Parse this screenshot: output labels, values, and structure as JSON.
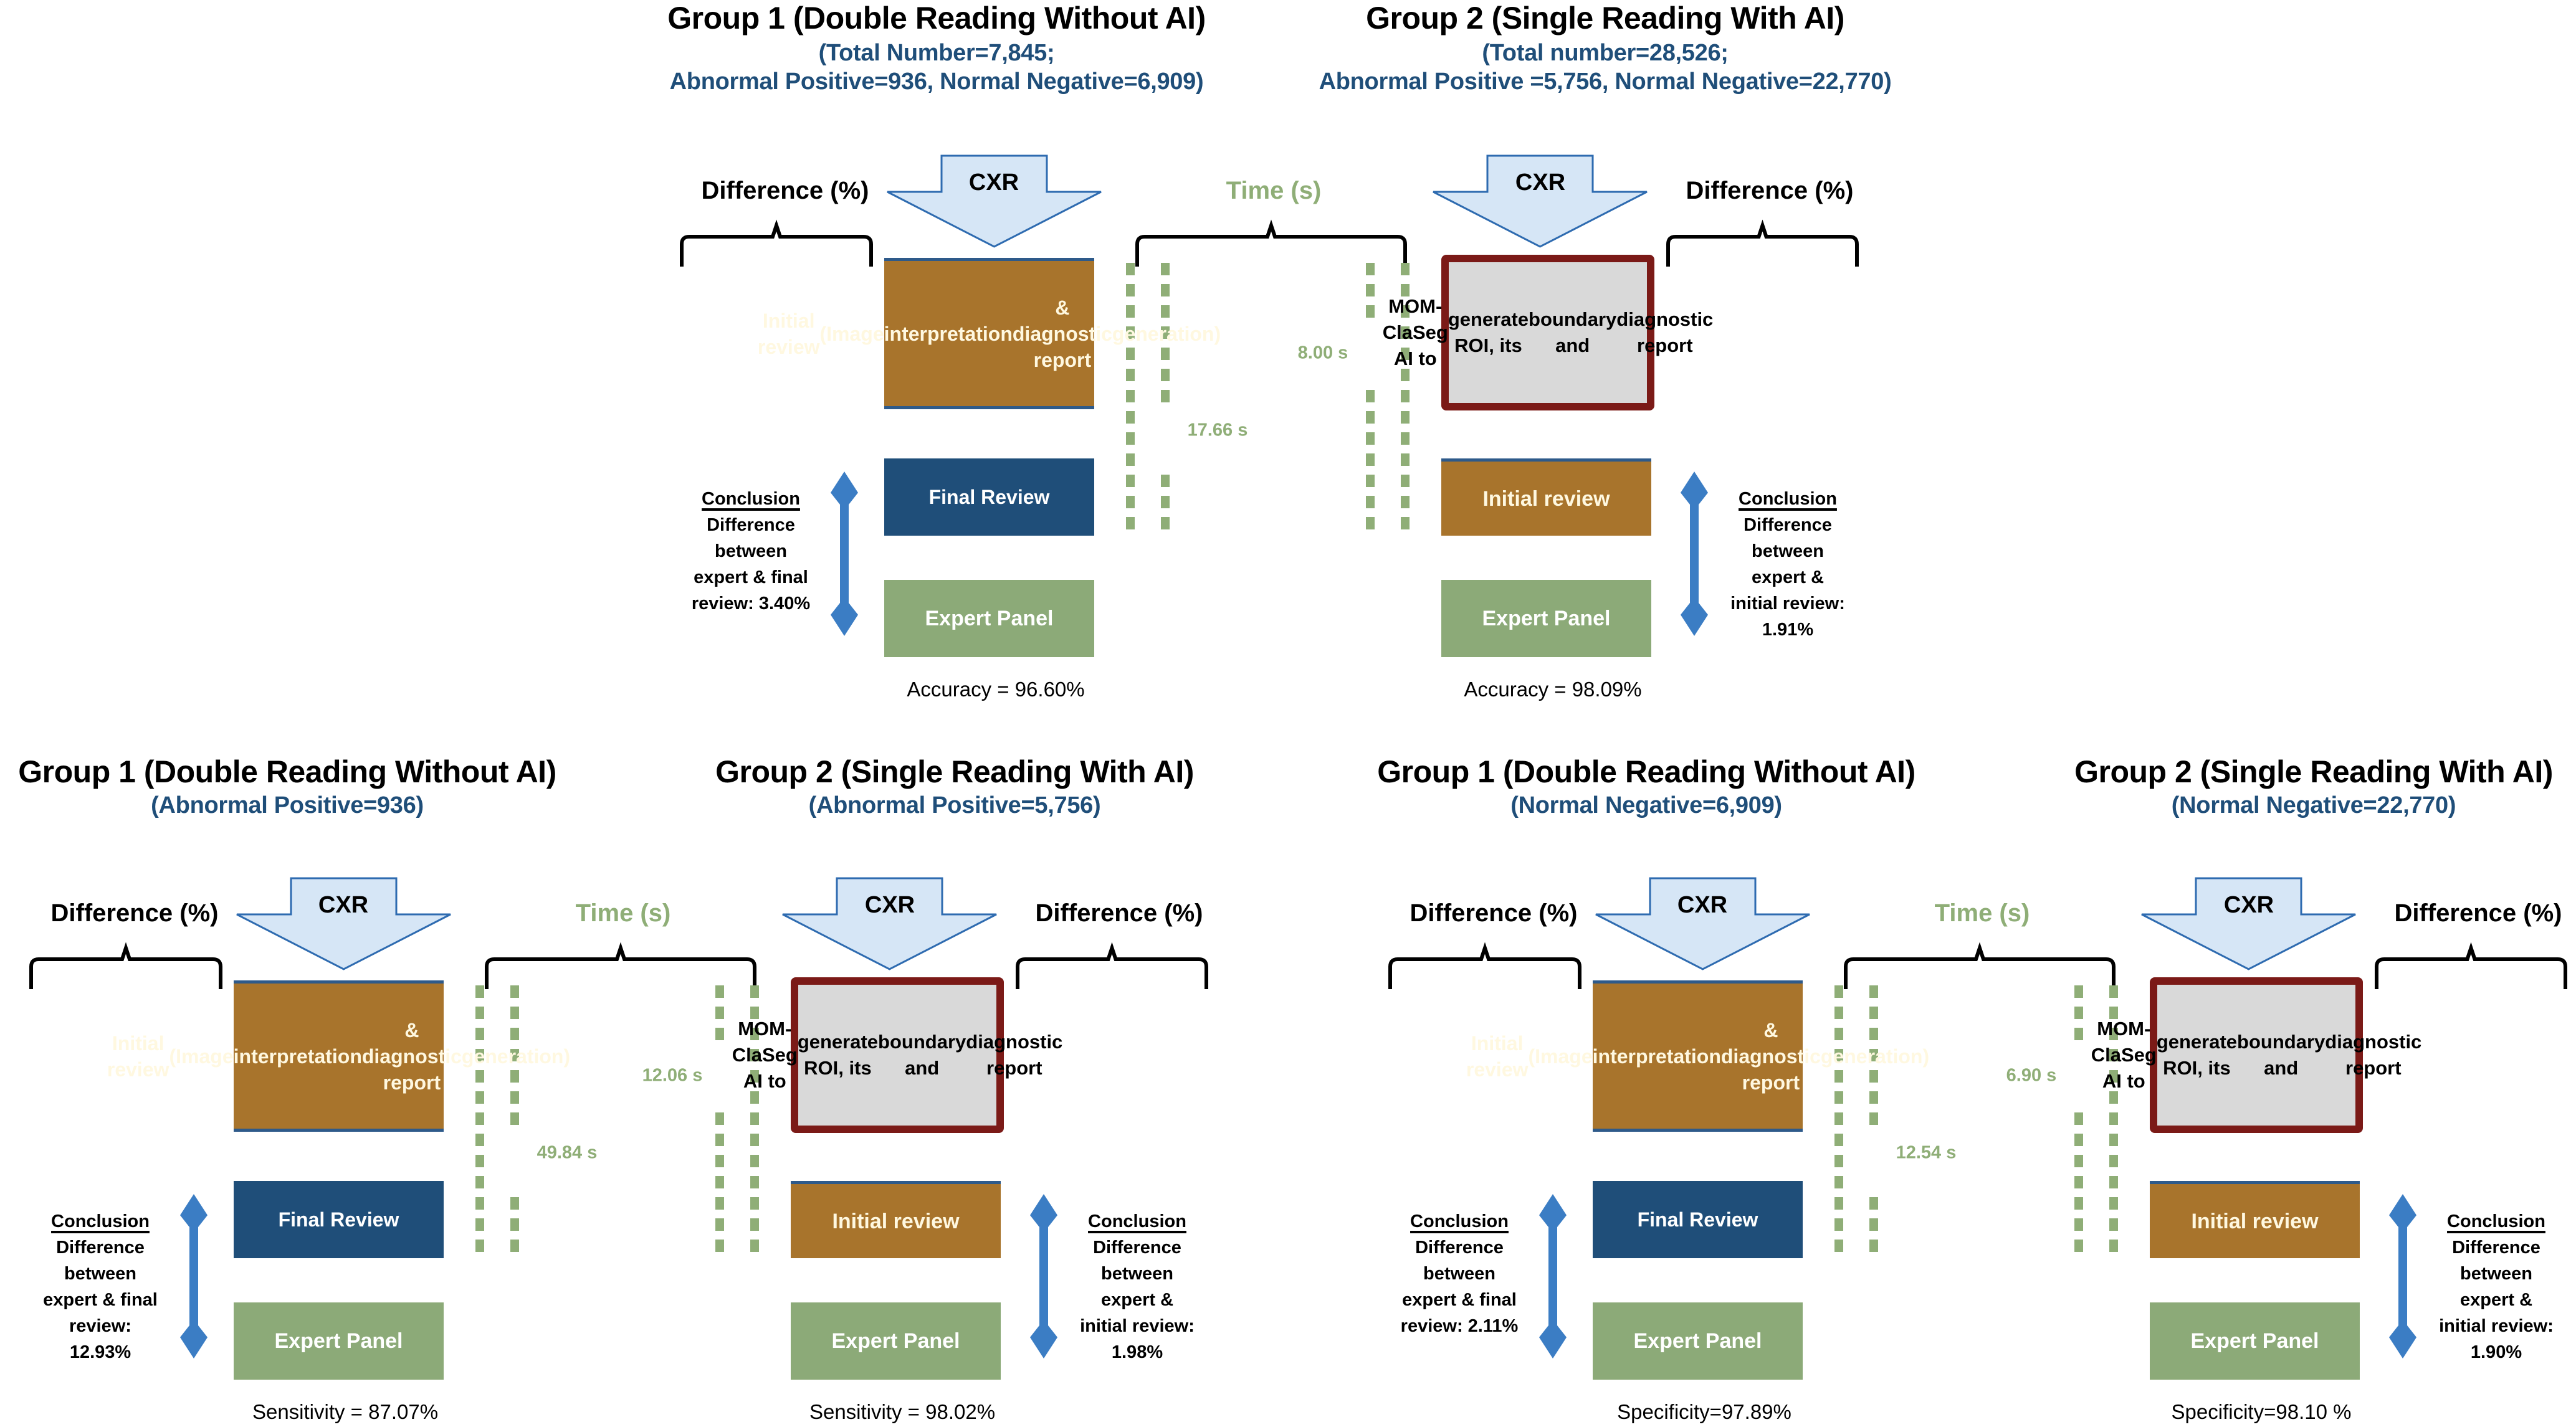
{
  "panels": [
    {
      "id": "overall",
      "group1": {
        "title": "Group 1 (Double Reading Without AI)",
        "subtitle_lines": [
          "(Total Number=7,845;",
          "Abnormal Positive=936, Normal Negative=6,909)"
        ]
      },
      "group2": {
        "title": "Group 2 (Single Reading With AI)",
        "subtitle_lines": [
          "(Total number=28,526;",
          "Abnormal Positive =5,756, Normal Negative=22,770)"
        ]
      },
      "g1_time": "17.66 s",
      "g2_time": "8.00 s",
      "g1_conclusion": [
        "Difference",
        "between",
        "expert & final",
        "review: 3.40%"
      ],
      "g2_conclusion": [
        "Difference",
        "between",
        "expert &",
        "initial review:",
        "1.91%"
      ],
      "g1_metric": "Accuracy = 96.60%",
      "g2_metric": "Accuracy = 98.09%"
    },
    {
      "id": "abnormal",
      "group1": {
        "title": "Group 1 (Double Reading Without AI)",
        "subtitle_lines": [
          "(Abnormal Positive=936)"
        ]
      },
      "group2": {
        "title": "Group 2 (Single Reading With AI)",
        "subtitle_lines": [
          "(Abnormal Positive=5,756)"
        ]
      },
      "g1_time": "49.84 s",
      "g2_time": "12.06 s",
      "g1_conclusion": [
        "Difference",
        "between",
        "expert & final",
        "review:",
        "12.93%"
      ],
      "g2_conclusion": [
        "Difference",
        "between",
        "expert &",
        "initial review:",
        "1.98%"
      ],
      "g1_metric": "Sensitivity = 87.07%",
      "g2_metric": "Sensitivity = 98.02%"
    },
    {
      "id": "normal",
      "group1": {
        "title": "Group 1 (Double Reading Without AI)",
        "subtitle_lines": [
          "(Normal Negative=6,909)"
        ]
      },
      "group2": {
        "title": "Group 2 (Single Reading With AI)",
        "subtitle_lines": [
          "(Normal Negative=22,770)"
        ]
      },
      "g1_time": "12.54 s",
      "g2_time": "6.90 s",
      "g1_conclusion": [
        "Difference",
        "between",
        "expert & final",
        "review: 2.11%"
      ],
      "g2_conclusion": [
        "Difference",
        "between",
        "expert &",
        "initial review:",
        "1.90%"
      ],
      "g1_metric": "Specificity=97.89%",
      "g2_metric": "Specificity=98.10 %"
    }
  ],
  "labels": {
    "difference": "Difference (%)",
    "time": "Time (s)",
    "cxr": "CXR",
    "g1_initial_review": [
      "Initial review",
      "(Image",
      "interpretation",
      "& diagnostic report",
      "generation)"
    ],
    "ai_box": [
      "MOM-ClaSeg AI to",
      "generate ROI, its",
      "boundary and",
      "diagnostic report"
    ],
    "final_review": "Final Review",
    "initial_review": "Initial review",
    "expert_panel": "Expert Panel",
    "conclusion_heading": "Conclusion"
  },
  "colors": {
    "initial_review_fill": "#a8742c",
    "final_review_fill": "#1f4e79",
    "expert_panel_fill": "#8caa78",
    "ai_box_fill": "#d9d9d9",
    "ai_box_border": "#7b1a17",
    "cxr_arrow_fill": "#d6e6f6",
    "double_arrow": "#3b7dc4",
    "time_dots": "#8fae77",
    "subtitle_text": "#1f4e79"
  }
}
